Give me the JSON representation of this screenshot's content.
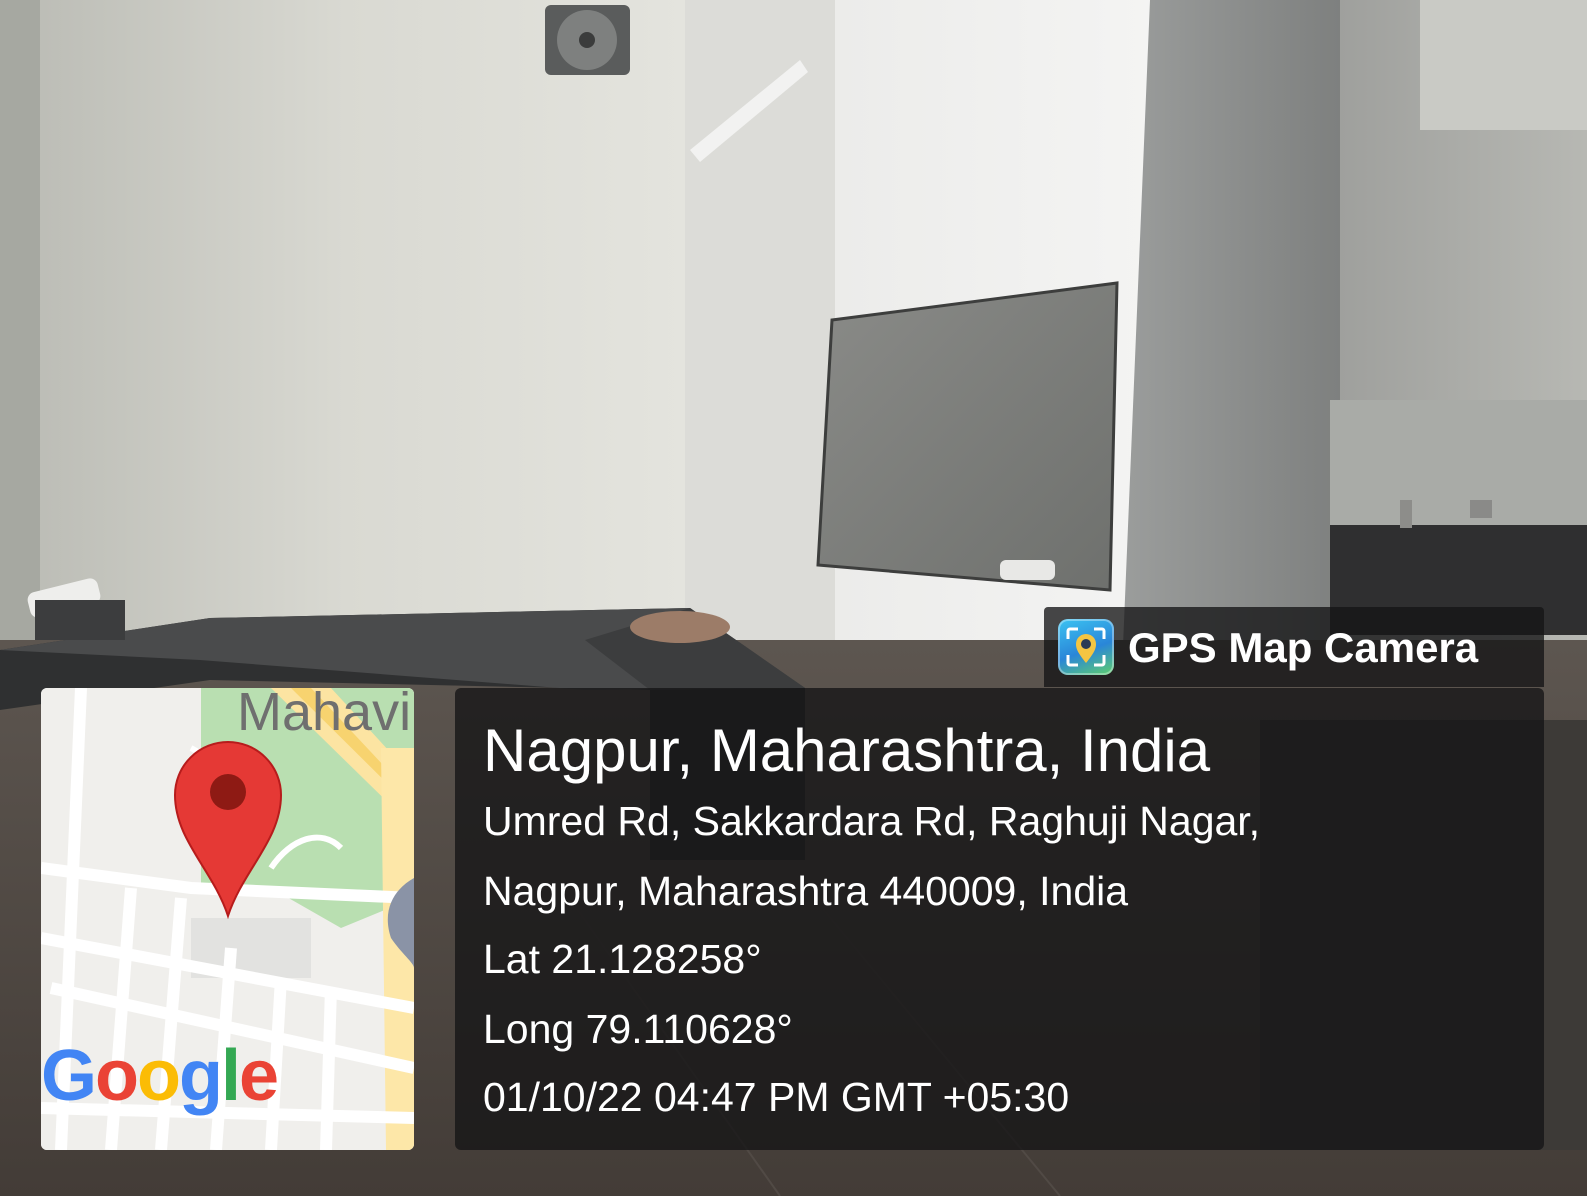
{
  "watermark": {
    "app_name": "GPS Map Camera",
    "app_icon": "gps-map-camera-app-icon"
  },
  "location": {
    "city_line": "Nagpur, Maharashtra, India",
    "address_line_1": "Umred Rd, Sakkardara Rd, Raghuji Nagar,",
    "address_line_2": "Nagpur, Maharashtra 440009, India",
    "latitude": "Lat 21.128258°",
    "longitude": "Long 79.110628°",
    "timestamp": "01/10/22 04:47 PM GMT +05:30"
  },
  "map": {
    "street_label": "Mahavi",
    "pin_icon": "map-pin-icon",
    "logo_text": "Google",
    "logo_colors": [
      "#4285f4",
      "#ea4335",
      "#fbbc05",
      "#4285f4",
      "#34a853",
      "#ea4335"
    ],
    "pin_color": "#e53935"
  },
  "colors": {
    "panel_background": "#141416",
    "text": "#ffffff"
  }
}
